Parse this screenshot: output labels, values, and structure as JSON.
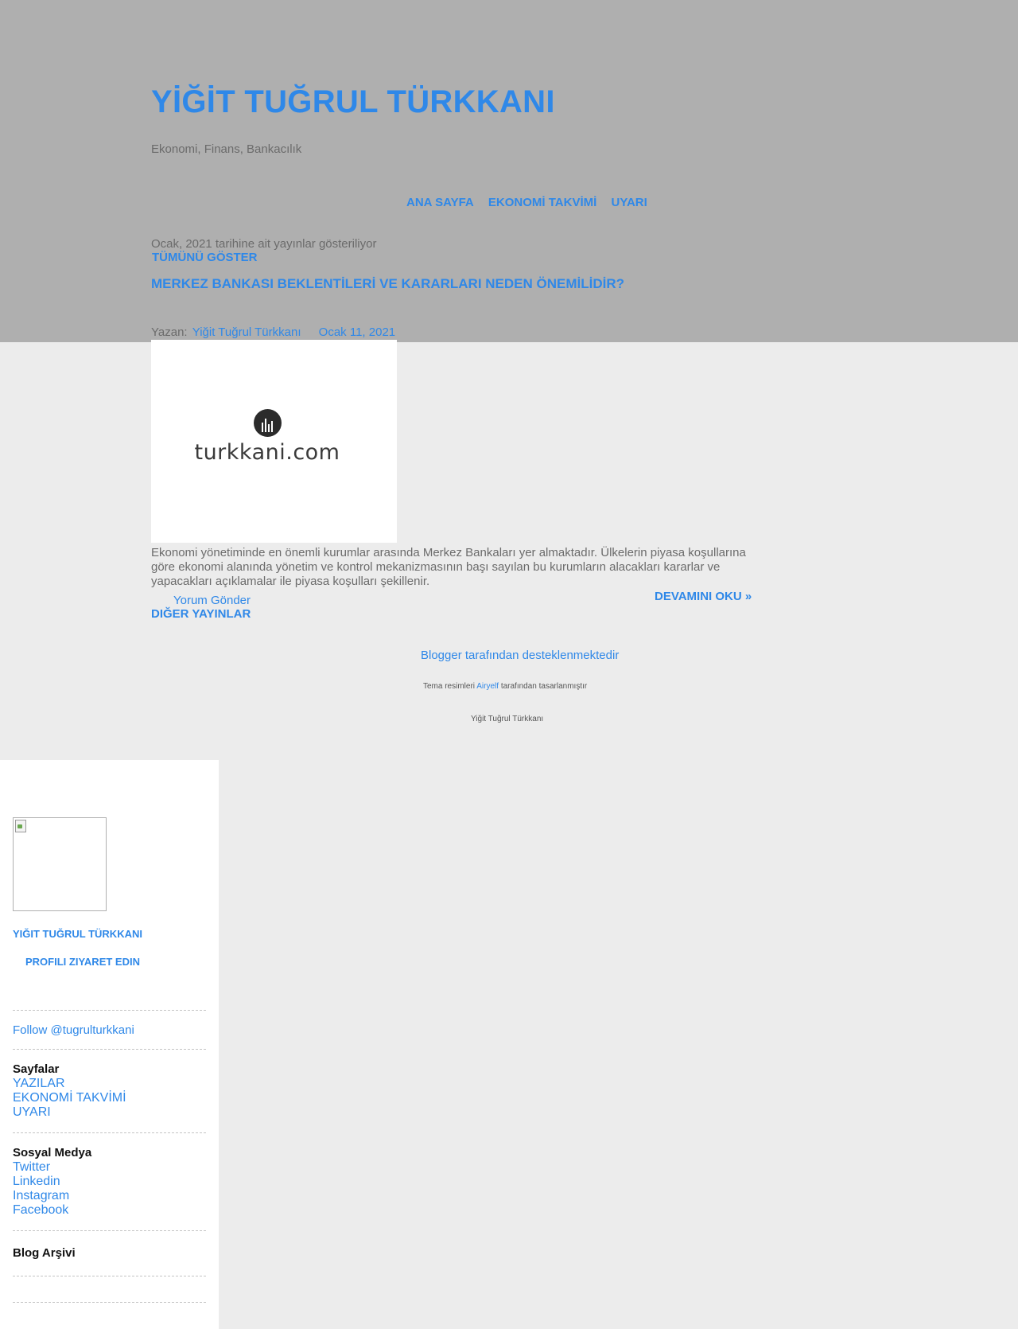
{
  "header": {
    "title": "YİĞİT TUĞRUL TÜRKKANI",
    "description": "Ekonomi, Finans, Bankacılık"
  },
  "nav": {
    "items": [
      "ANA SAYFA",
      "EKONOMİ TAKVİMİ",
      "UYARI"
    ]
  },
  "archive": {
    "note": "Ocak, 2021 tarihine ait yayınlar gösteriliyor",
    "show_all": "TÜMÜNÜ GÖSTER"
  },
  "post": {
    "title": "MERKEZ BANKASI BEKLENTİLERİ VE KARARLARI NEDEN ÖNEMİLİDİR?",
    "byline_prefix": "Yazan:",
    "author": "Yiğit Tuğrul Türkkanı",
    "date": "Ocak 11, 2021",
    "image_wordmark": "turkkani.com",
    "body": "Ekonomi yönetiminde en önemli kurumlar arasında Merkez Bankaları yer almaktadır. Ülkelerin piyasa koşullarına göre ekonomi alanında yönetim ve kontrol mekanizmasının başı sayılan bu kurumların alacakları kararlar ve yapacakları açıklamalar ile piyasa koşulları şekillenir.",
    "comment_link": "Yorum Gönder",
    "read_more": "DEVAMINI OKU »"
  },
  "older_posts": "DIĞER YAYINLAR",
  "footer": {
    "powered_by": "Blogger tarafından desteklenmektedir",
    "theme_prefix": "Tema resimleri",
    "theme_author": "Airyelf",
    "theme_suffix": "tarafından tasarlanmıştır",
    "name": "Yiğit Tuğrul Türkkanı"
  },
  "sidebar": {
    "profile_name": "YIĞIT TUĞRUL TÜRKKANI",
    "profile_visit": "PROFILI ZIYARET EDIN",
    "follow": "Follow @tugrulturkkani",
    "pages_heading": "Sayfalar",
    "pages": [
      "YAZILAR",
      "EKONOMİ TAKVİMİ",
      "UYARI"
    ],
    "social_heading": "Sosyal Medya",
    "social": [
      "Twitter",
      "Linkedin",
      "Instagram",
      "Facebook"
    ],
    "archive_heading": "Blog Arşivi"
  },
  "colors": {
    "header_band": "#afafaf",
    "page_background": "#ececec",
    "link": "#2f88e8",
    "text": "#6b6b6b"
  },
  "icons": {
    "logo": "bar-chart-circle-icon",
    "profile_image": "broken-image-icon"
  }
}
